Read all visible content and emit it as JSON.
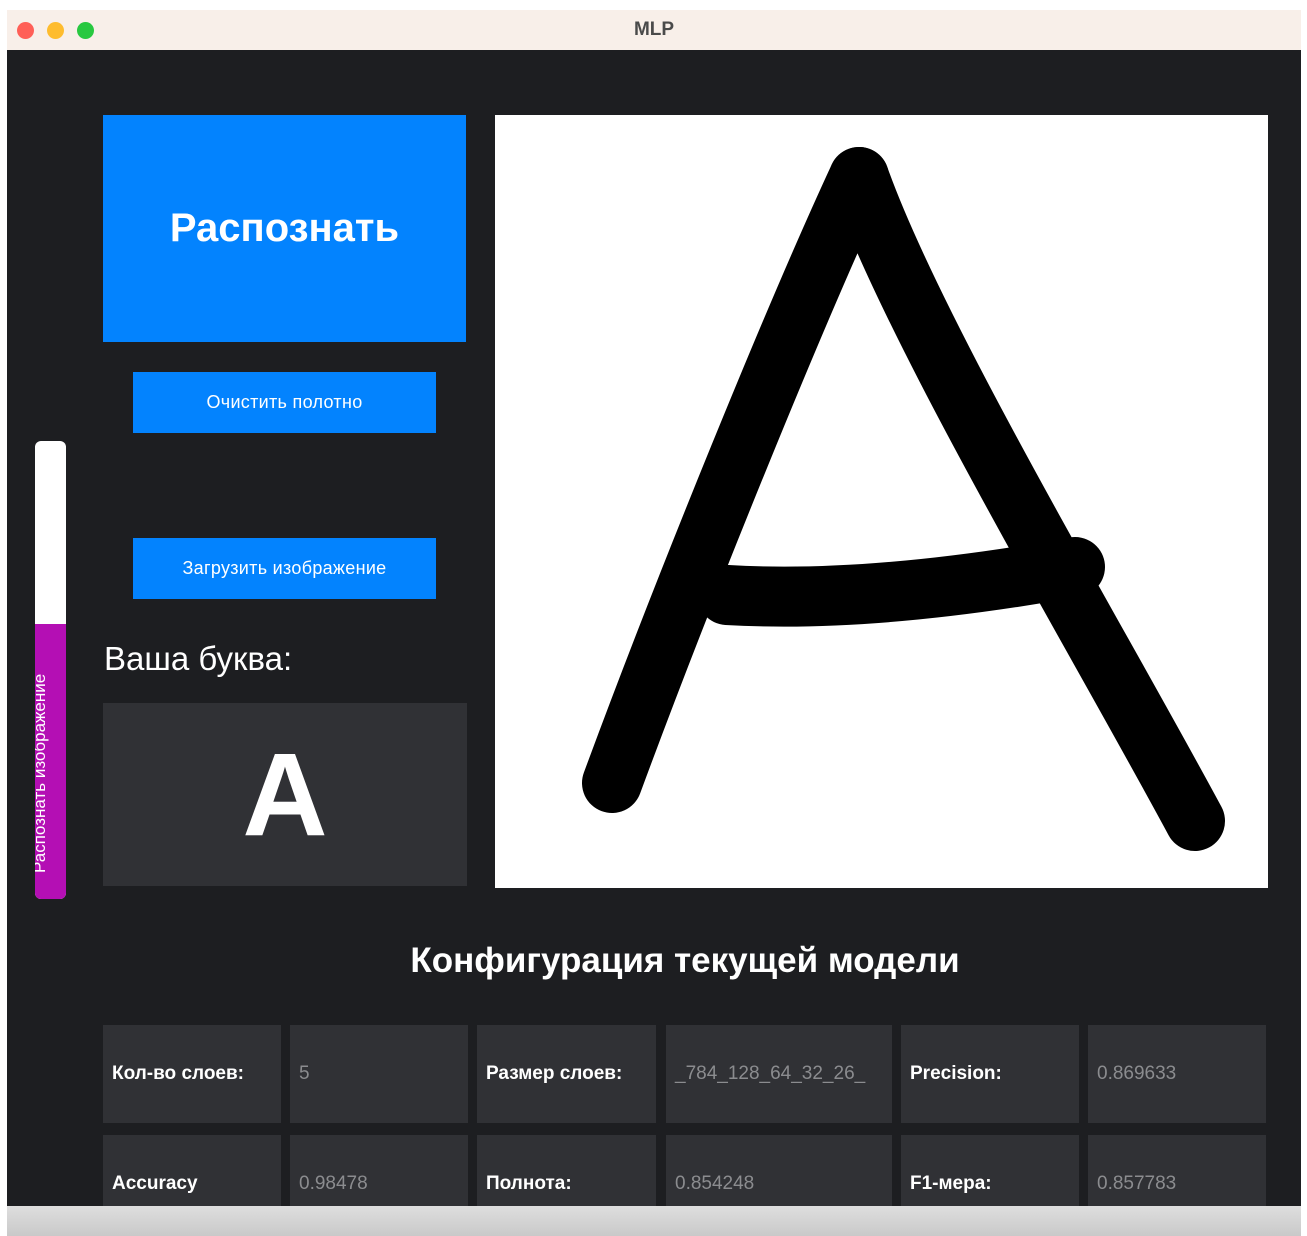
{
  "window": {
    "title": "MLP"
  },
  "controls": {
    "recognize_label": "Распознать",
    "clear_label": "Очистить полотно",
    "load_label": "Загрузить изображение",
    "side_slider_label": "Распознать изображение",
    "side_slider_fill_fraction": 0.6
  },
  "result": {
    "label": "Ваша буква:",
    "letter": "A"
  },
  "config": {
    "heading": "Конфигурация текущей модели",
    "rows": [
      [
        {
          "label": "Кол-во слоев:",
          "value": "5"
        },
        {
          "label": "Размер слоев:",
          "value": "_784_128_64_32_26_"
        },
        {
          "label": "Precision:",
          "value": "0.869633"
        }
      ],
      [
        {
          "label": "Accuracy",
          "value": "0.98478"
        },
        {
          "label": "Полнота:",
          "value": "0.854248"
        },
        {
          "label": "F1-мера:",
          "value": "0.857783"
        }
      ]
    ]
  },
  "colors": {
    "accent_blue": "#0383fe",
    "slider_purple": "#b40fb4",
    "background": "#1d1e21",
    "cell": "#303135"
  }
}
